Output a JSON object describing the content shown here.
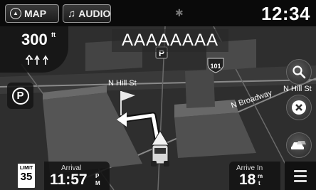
{
  "topbar": {
    "map_label": "MAP",
    "audio_label": "AUDIO",
    "bluetooth_icon": "bluetooth-icon",
    "clock": "12:34"
  },
  "maneuver": {
    "distance": "300",
    "unit": "ft",
    "lane_icon": "lane-guidance-icon"
  },
  "street_banner": {
    "text": "AAAAAAAA"
  },
  "map": {
    "street_labels": [
      "N Hill St",
      "N Hill St",
      "N Broadway"
    ],
    "highway_shield": "101",
    "colors": {
      "map_background": "#2e2e2e",
      "building": "#4a4a4a",
      "route": "#ffffff"
    }
  },
  "buttons": {
    "parking_label": "P",
    "search_icon": "search-icon",
    "cancel_icon": "cancel-route-icon",
    "traffic_icon": "traffic-icon",
    "menu_icon": "menu-icon"
  },
  "bottombar": {
    "speed_limit_label": "LIMIT",
    "speed_limit_value": "35",
    "arrival_label": "Arrival",
    "arrival_time": "11:57",
    "arrival_suffix_top": "P",
    "arrival_suffix_bottom": "M",
    "arrive_in_label": "Arrive In",
    "arrive_in_value": "18",
    "arrive_in_suffix_top": "m",
    "arrive_in_suffix_bottom": "t"
  }
}
